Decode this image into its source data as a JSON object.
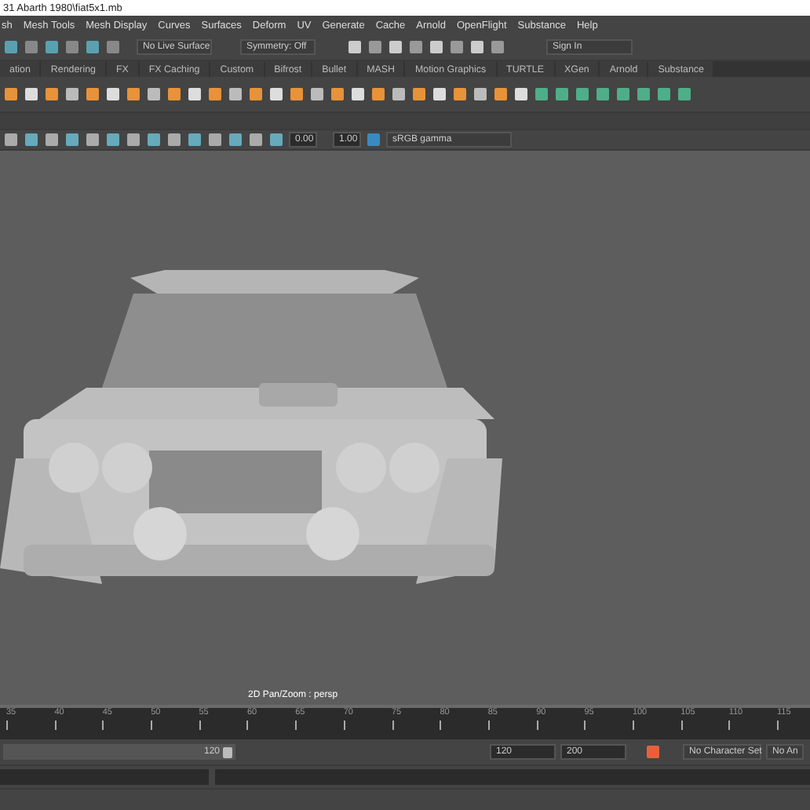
{
  "window": {
    "title": "31 Abarth 1980\\fiat5x1.mb"
  },
  "menu": [
    "sh",
    "Mesh Tools",
    "Mesh Display",
    "Curves",
    "Surfaces",
    "Deform",
    "UV",
    "Generate",
    "Cache",
    "Arnold",
    "OpenFlight",
    "Substance",
    "Help"
  ],
  "status_line": {
    "live_surface": "No Live Surface",
    "symmetry": "Symmetry: Off",
    "sign_in": "Sign In"
  },
  "shelf_tabs": [
    {
      "label": "ation",
      "selected": false
    },
    {
      "label": "Rendering",
      "selected": false
    },
    {
      "label": "FX",
      "selected": false
    },
    {
      "label": "FX Caching",
      "selected": false
    },
    {
      "label": "Custom",
      "selected": false
    },
    {
      "label": "Bifrost",
      "selected": false
    },
    {
      "label": "Bullet",
      "selected": false
    },
    {
      "label": "MASH",
      "selected": false
    },
    {
      "label": "Motion Graphics",
      "selected": false
    },
    {
      "label": "TURTLE",
      "selected": false
    },
    {
      "label": "XGen",
      "selected": false
    },
    {
      "label": "Arnold",
      "selected": false
    },
    {
      "label": "Substance",
      "selected": false
    }
  ],
  "viewport_toolbar": {
    "exposure": "0.00",
    "gamma": "1.00",
    "color_space": "sRGB gamma"
  },
  "viewport": {
    "camera_label": "2D Pan/Zoom : persp"
  },
  "timeline": {
    "ticks": [
      "35",
      "40",
      "45",
      "50",
      "55",
      "60",
      "65",
      "70",
      "75",
      "80",
      "85",
      "90",
      "95",
      "100",
      "105",
      "110",
      "115"
    ]
  },
  "range": {
    "level": 1,
    "slider_end": "120",
    "end_field": "120",
    "max_field": "200",
    "character_set": "No Character Set",
    "anim_layer": "No An"
  }
}
